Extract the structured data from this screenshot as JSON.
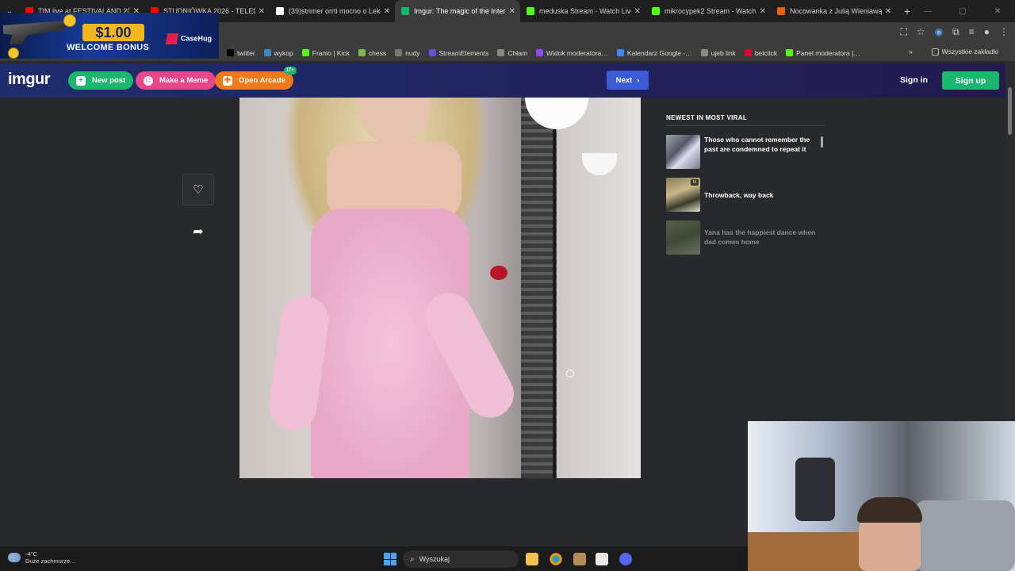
{
  "browser": {
    "tabs": [
      {
        "title": "TIM live at FESTIVALAND 20…",
        "color": "#ff0000"
      },
      {
        "title": "STUDNIÓWKA 2026 - TELEDYS…",
        "color": "#ff0000"
      },
      {
        "title": "(39)strimer orrti mocno o Leka…",
        "color": "#ffffff"
      },
      {
        "title": "Imgur: The magic of the Intern…",
        "color": "#1bb76e",
        "active": true
      },
      {
        "title": "meduska Stream - Watch Live o…",
        "color": "#53fc18"
      },
      {
        "title": "mikrocypek2 Stream - Watch Li…",
        "color": "#53fc18"
      },
      {
        "title": "Nocowanka z Julią Wieniawą 1…",
        "color": "#e36209"
      }
    ],
    "bookmarks": [
      {
        "label": "twitter",
        "icon": "x-icon",
        "color": "#000000"
      },
      {
        "label": "wykop",
        "icon": "wykop-icon",
        "color": "#3b89c6"
      },
      {
        "label": "Franio | Kick",
        "icon": "kick-icon",
        "color": "#53fc18"
      },
      {
        "label": "chess",
        "icon": "pawn-icon",
        "color": "#81b64c"
      },
      {
        "label": "nudy",
        "icon": "folder-icon",
        "color": "#777777"
      },
      {
        "label": "StreamElements",
        "icon": "streamelements-icon",
        "color": "#6c4bd6"
      },
      {
        "label": "Chłam",
        "icon": "globe-icon",
        "color": "#888888"
      },
      {
        "label": "Widok moderatora…",
        "icon": "twitch-icon",
        "color": "#9146ff"
      },
      {
        "label": "Kalendarz Google -…",
        "icon": "calendar-icon",
        "color": "#4285f4"
      },
      {
        "label": "ujeb link",
        "icon": "globe-icon",
        "color": "#888888"
      },
      {
        "label": "betclick",
        "icon": "betclick-icon",
        "color": "#e4002b"
      },
      {
        "label": "Panel moderatora |…",
        "icon": "kick-icon",
        "color": "#53fc18"
      }
    ],
    "bookmarks_more": "»",
    "all_bookmarks": "Wszystkie zakładki"
  },
  "ad": {
    "amount": "$1.00",
    "bonus": "WELCOME BONUS",
    "brand": "CaseHug"
  },
  "imgur": {
    "logo": "imgur",
    "new_post": "New post",
    "make_meme": "Make a Meme",
    "open_arcade": "Open Arcade",
    "arcade_badge": "17+",
    "next": "Next",
    "sign_in": "Sign in",
    "sign_up": "Sign up",
    "sidebar_title": "NEWEST IN MOST VIRAL",
    "viral": [
      {
        "title": "Those who cannot remember the past are condemned to repeat it",
        "count": ""
      },
      {
        "title": "Throwback, way back",
        "count": "11"
      },
      {
        "title": "Yana has the happiest dance when dad comes home",
        "count": ""
      }
    ]
  },
  "taskbar": {
    "temperature": "-4°C",
    "weather_desc": "Duże zachmurze…",
    "search_placeholder": "Wyszukaj"
  }
}
